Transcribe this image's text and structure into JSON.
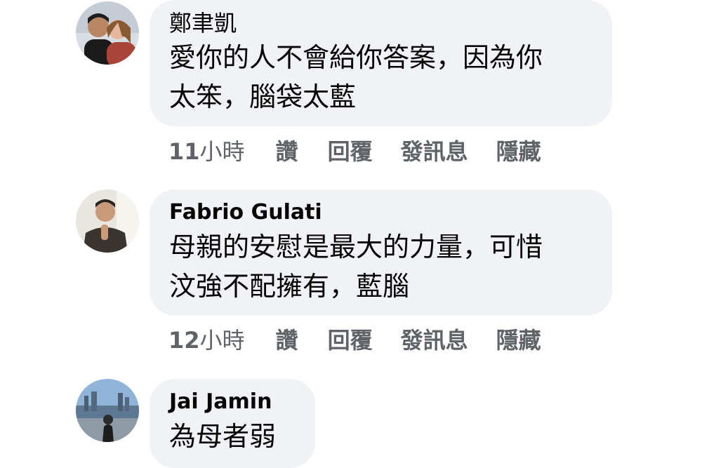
{
  "comments": [
    {
      "author": "鄭聿凱",
      "text": "愛你的人不會給你答案，因為你\n太笨，腦袋太藍",
      "time_num": "11",
      "time_unit": "小時",
      "actions": [
        "讚",
        "回覆",
        "發訊息",
        "隱藏"
      ],
      "avatar_icon": "profile-photo-couple"
    },
    {
      "author": "Fabrio Gulati",
      "text": "母親的安慰是最大的力量，可惜\n汶強不配擁有，藍腦",
      "time_num": "12",
      "time_unit": "小時",
      "actions": [
        "讚",
        "回覆",
        "發訊息",
        "隱藏"
      ],
      "avatar_icon": "profile-photo-person"
    },
    {
      "author": "Jai Jamin",
      "text": "為母者弱",
      "avatar_icon": "profile-photo-cityscape"
    }
  ],
  "colors": {
    "bubble": "#f0f2f5",
    "text": "#050505",
    "meta": "#5f6368"
  }
}
